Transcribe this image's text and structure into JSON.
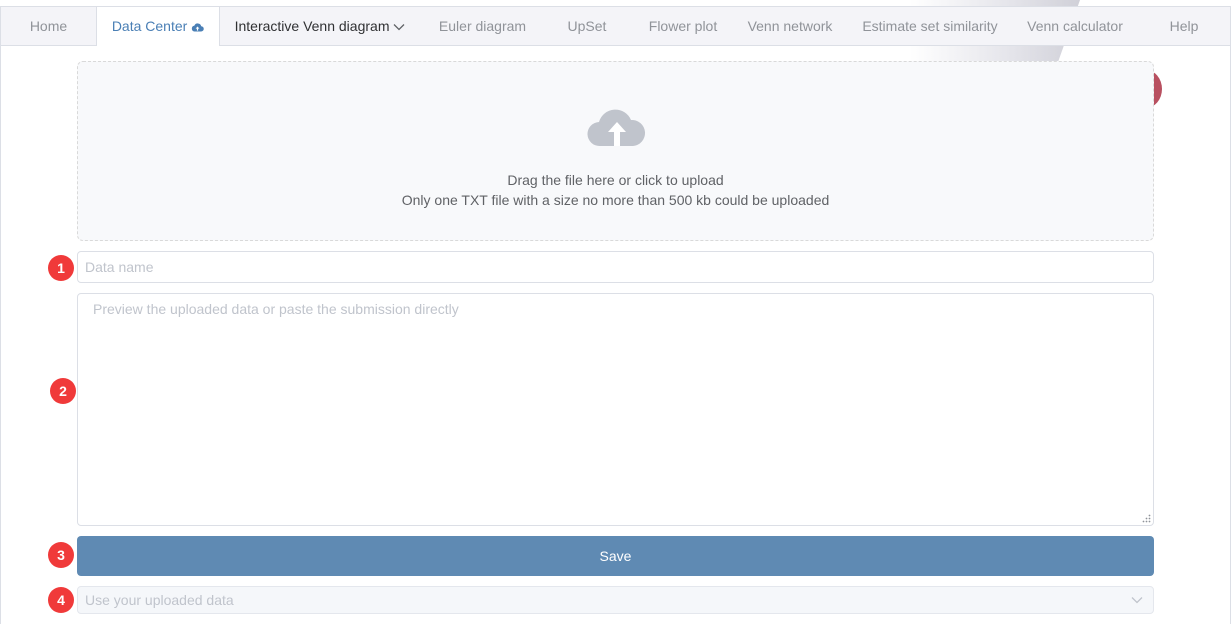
{
  "nav": {
    "items": [
      {
        "label": "Home"
      },
      {
        "label": "Data Center"
      },
      {
        "label": "Interactive Venn diagram"
      },
      {
        "label": "Euler diagram"
      },
      {
        "label": "UpSet"
      },
      {
        "label": "Flower plot"
      },
      {
        "label": "Venn network"
      },
      {
        "label": "Estimate set similarity"
      },
      {
        "label": "Venn calculator"
      },
      {
        "label": "Help"
      }
    ],
    "active": "Data Center"
  },
  "upload": {
    "icon": "cloud-upload-icon",
    "line1": "Drag the file here or click to upload",
    "line2": "Only one TXT file with a size no more than 500 kb could be uploaded"
  },
  "steps": {
    "s1": "1",
    "s2": "2",
    "s3": "3",
    "s4": "4"
  },
  "form": {
    "name_placeholder": "Data name",
    "name_value": "",
    "data_placeholder": "Preview the uploaded data or paste the submission directly",
    "save_label": "Save",
    "select_placeholder": "Use your uploaded data"
  },
  "colors": {
    "accent": "#5f8ab3",
    "badge": "#f03a3a",
    "active_tab_text": "#4a7fb5"
  }
}
